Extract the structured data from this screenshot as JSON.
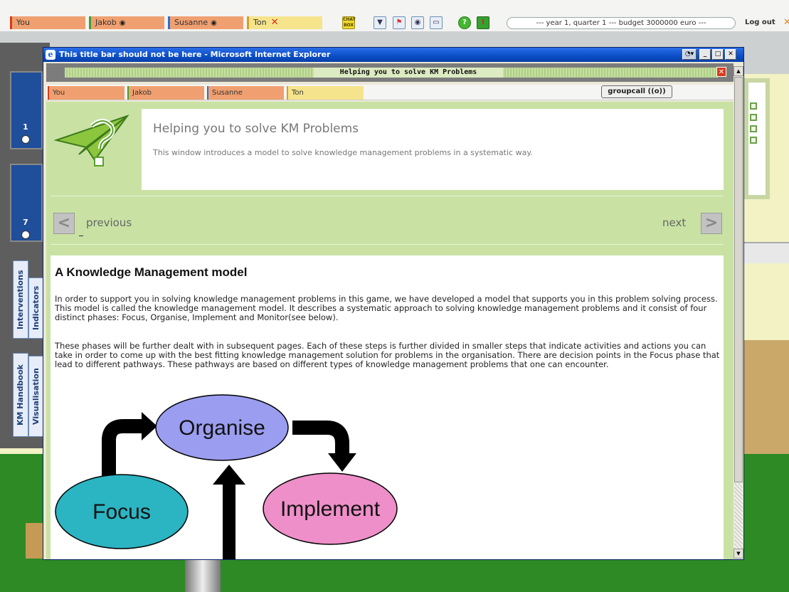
{
  "topbar": {
    "players": [
      {
        "name": "You",
        "status": ""
      },
      {
        "name": "Jakob",
        "status": "eye"
      },
      {
        "name": "Susanne",
        "status": "eye"
      },
      {
        "name": "Ton",
        "status": "x"
      }
    ],
    "chat_box_label": "CHAT BOX",
    "budget_text": "--- year 1, quarter 1 --- budget 3000000 euro ---",
    "logout_label": "Log out",
    "colors": {
      "you": "#f0a070",
      "jakob": "#f0a070",
      "susanne": "#f0a070",
      "ton": "#f6e48c"
    }
  },
  "side_panel": {
    "numbers": [
      "1",
      "7"
    ],
    "tabs": [
      "Interventions",
      "Indicators",
      "KM Handbook",
      "Visualisation"
    ]
  },
  "window": {
    "title": "This title bar should not be here - Microsoft Internet Explorer",
    "page_title": "Helping you to solve KM Problems",
    "players": [
      "You",
      "Jakob",
      "Susanne",
      "Ton"
    ],
    "player_colors": [
      "#f0a070",
      "#f0a070",
      "#f0a070",
      "#f6e48c"
    ],
    "groupcall_label": "groupcall ((o))",
    "intro": {
      "title": "Helping you to solve KM Problems",
      "description": "This window introduces a model to solve knowledge management problems in a systematic way."
    },
    "nav": {
      "previous": "previous",
      "next": "next"
    },
    "article": {
      "heading": "A Knowledge Management model",
      "paragraph1": "In order to support you in solving knowledge management problems in this game, we have developed a model that supports you in this problem solving process. This model is called the knowledge management model. It describes a systematic approach to solving knowledge management problems and it consist of four distinct phases: Focus, Organise, Implement and Monitor(see below).",
      "paragraph2": "These phases will be further dealt with in subsequent pages. Each of these steps is further divided in smaller steps that indicate activities and actions you can take in order to come up with the best fitting knowledge management solution for problems in the organisation. There are decision points in the Focus phase that lead to different pathways. These pathways are based on different types of knowledge management problems that one can encounter."
    },
    "diagram": {
      "nodes": [
        {
          "label": "Organise",
          "color": "#9b9df0"
        },
        {
          "label": "Focus",
          "color": "#2bb4c2"
        },
        {
          "label": "Implement",
          "color": "#ee8fc9"
        }
      ]
    }
  }
}
